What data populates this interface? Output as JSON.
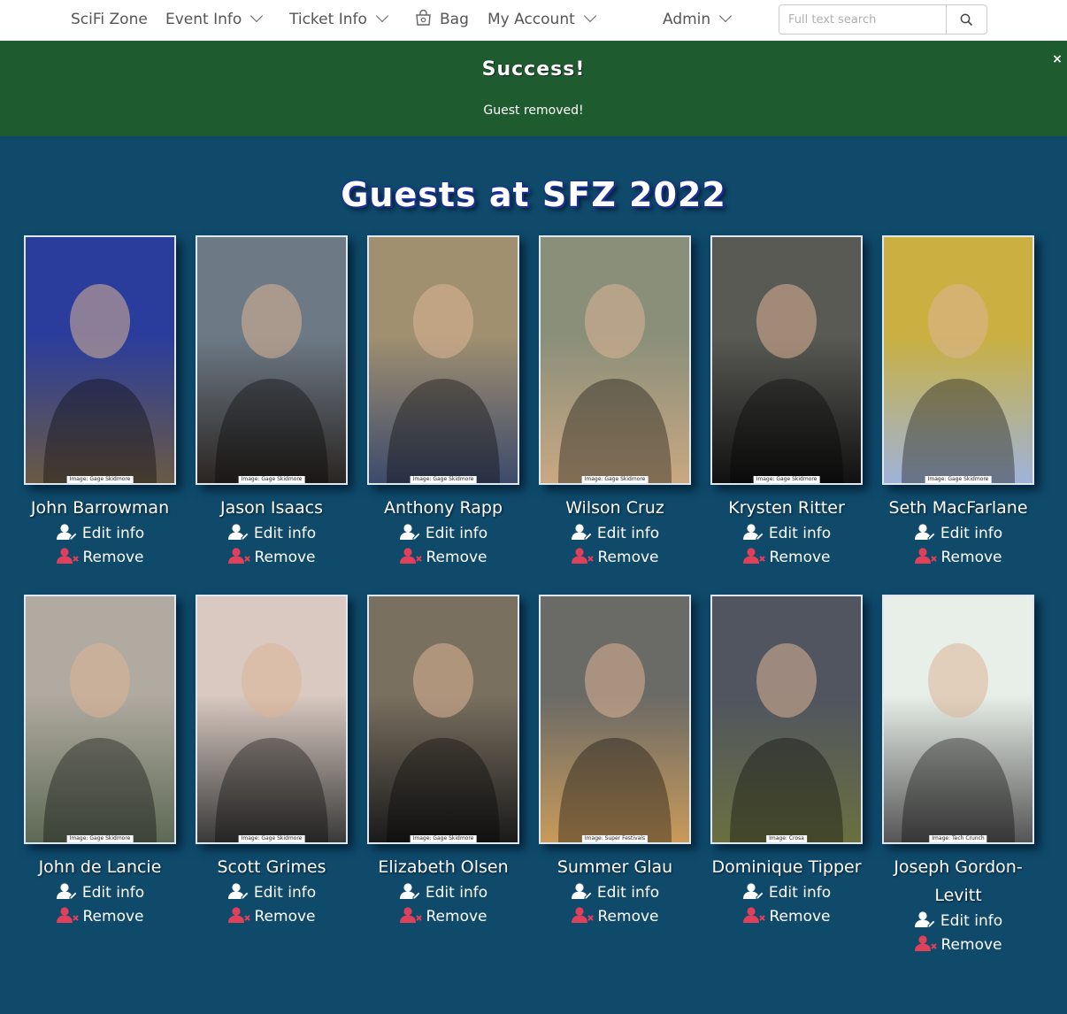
{
  "nav": {
    "brand": "SciFi Zone",
    "event_info": "Event Info",
    "ticket_info": "Ticket Info",
    "bag": "Bag",
    "my_account": "My Account",
    "admin": "Admin",
    "search_placeholder": "Full text search"
  },
  "alert": {
    "title": "Success!",
    "message": "Guest removed!",
    "close": "×"
  },
  "page_title": "Guests at SFZ 2022",
  "actions": {
    "edit": "Edit info",
    "remove": "Remove"
  },
  "guests": [
    {
      "name": "John Barrowman",
      "credit": "Image: Gage Skidmore",
      "colors": [
        "#2a3d9c",
        "#6a5a45"
      ]
    },
    {
      "name": "Jason Isaacs",
      "credit": "Image: Gage Skidmore",
      "colors": [
        "#6d7a86",
        "#2b2522"
      ]
    },
    {
      "name": "Anthony Rapp",
      "credit": "Image: Gage Skidmore",
      "colors": [
        "#a09070",
        "#3d4a6b"
      ]
    },
    {
      "name": "Wilson Cruz",
      "credit": "Image: Gage Skidmore",
      "colors": [
        "#8a8f7a",
        "#c9a882"
      ]
    },
    {
      "name": "Krysten Ritter",
      "credit": "Image: Gage Skidmore",
      "colors": [
        "#5a5a55",
        "#111111"
      ]
    },
    {
      "name": "Seth MacFarlane",
      "credit": "Image: Gage Skidmore",
      "colors": [
        "#c9b040",
        "#9fb3d9"
      ]
    },
    {
      "name": "John de Lancie",
      "credit": "Image: Gage Skidmore",
      "colors": [
        "#b0aaa0",
        "#5d6a55"
      ]
    },
    {
      "name": "Scott Grimes",
      "credit": "Image: Gage Skidmore",
      "colors": [
        "#d9c9c0",
        "#3a3a3a"
      ]
    },
    {
      "name": "Elizabeth Olsen",
      "credit": "Image: Gage Skidmore",
      "colors": [
        "#7a7060",
        "#1a1a1a"
      ]
    },
    {
      "name": "Summer Glau",
      "credit": "Image: Super Festivals",
      "colors": [
        "#6a6a66",
        "#c89a5a"
      ]
    },
    {
      "name": "Dominique Tipper",
      "credit": "Image: Crosa",
      "colors": [
        "#505560",
        "#6a7040"
      ]
    },
    {
      "name": "Joseph Gordon-Levitt",
      "credit": "Image: Tech Crunch",
      "colors": [
        "#e8efe8",
        "#555555"
      ]
    }
  ]
}
